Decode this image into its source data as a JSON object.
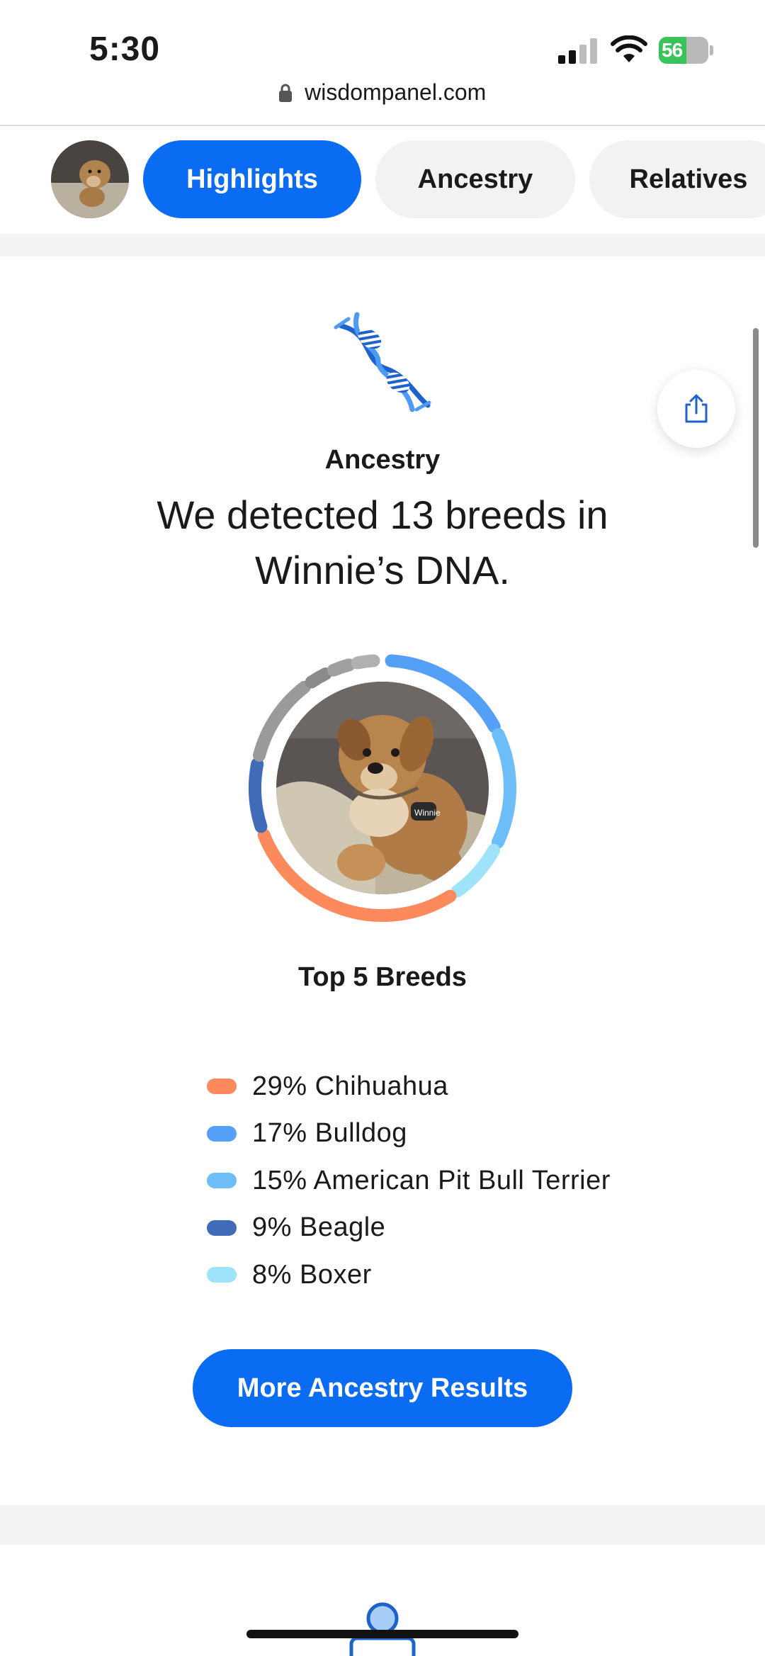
{
  "status_bar": {
    "time": "5:30",
    "battery_percent": "56",
    "battery_level": 0.56
  },
  "browser": {
    "url": "wisdompanel.com"
  },
  "tabs": [
    {
      "label": "Highlights",
      "active": true
    },
    {
      "label": "Ancestry",
      "active": false
    },
    {
      "label": "Relatives",
      "active": false
    }
  ],
  "ancestry": {
    "section_label": "Ancestry",
    "headline": "We detected 13 breeds in Winnie’s DNA.",
    "chart_title": "Top 5 Breeds",
    "dog_tag_text": "Winnie",
    "cta_label": "More Ancestry Results"
  },
  "chart_data": {
    "type": "pie",
    "title": "Top 5 Breeds",
    "series": [
      {
        "name": "Chihuahua",
        "value": 29,
        "label": "29% Chihuahua",
        "color": "#fc8a5c"
      },
      {
        "name": "Bulldog",
        "value": 17,
        "label": "17% Bulldog",
        "color": "#55a0f7"
      },
      {
        "name": "American Pit Bull Terrier",
        "value": 15,
        "label": "15% American Pit Bull Terrier",
        "color": "#6cbdf8"
      },
      {
        "name": "Beagle",
        "value": 9,
        "label": "9% Beagle",
        "color": "#3f6bb9"
      },
      {
        "name": "Boxer",
        "value": 8,
        "label": "8% Boxer",
        "color": "#9fe3fb"
      }
    ]
  },
  "colors": {
    "accent": "#0a6cf2",
    "band": "#f3f3f3"
  },
  "icons": [
    "lock-icon",
    "dna-icon",
    "share-icon",
    "cellular-signal-icon",
    "wifi-icon",
    "battery-icon"
  ]
}
